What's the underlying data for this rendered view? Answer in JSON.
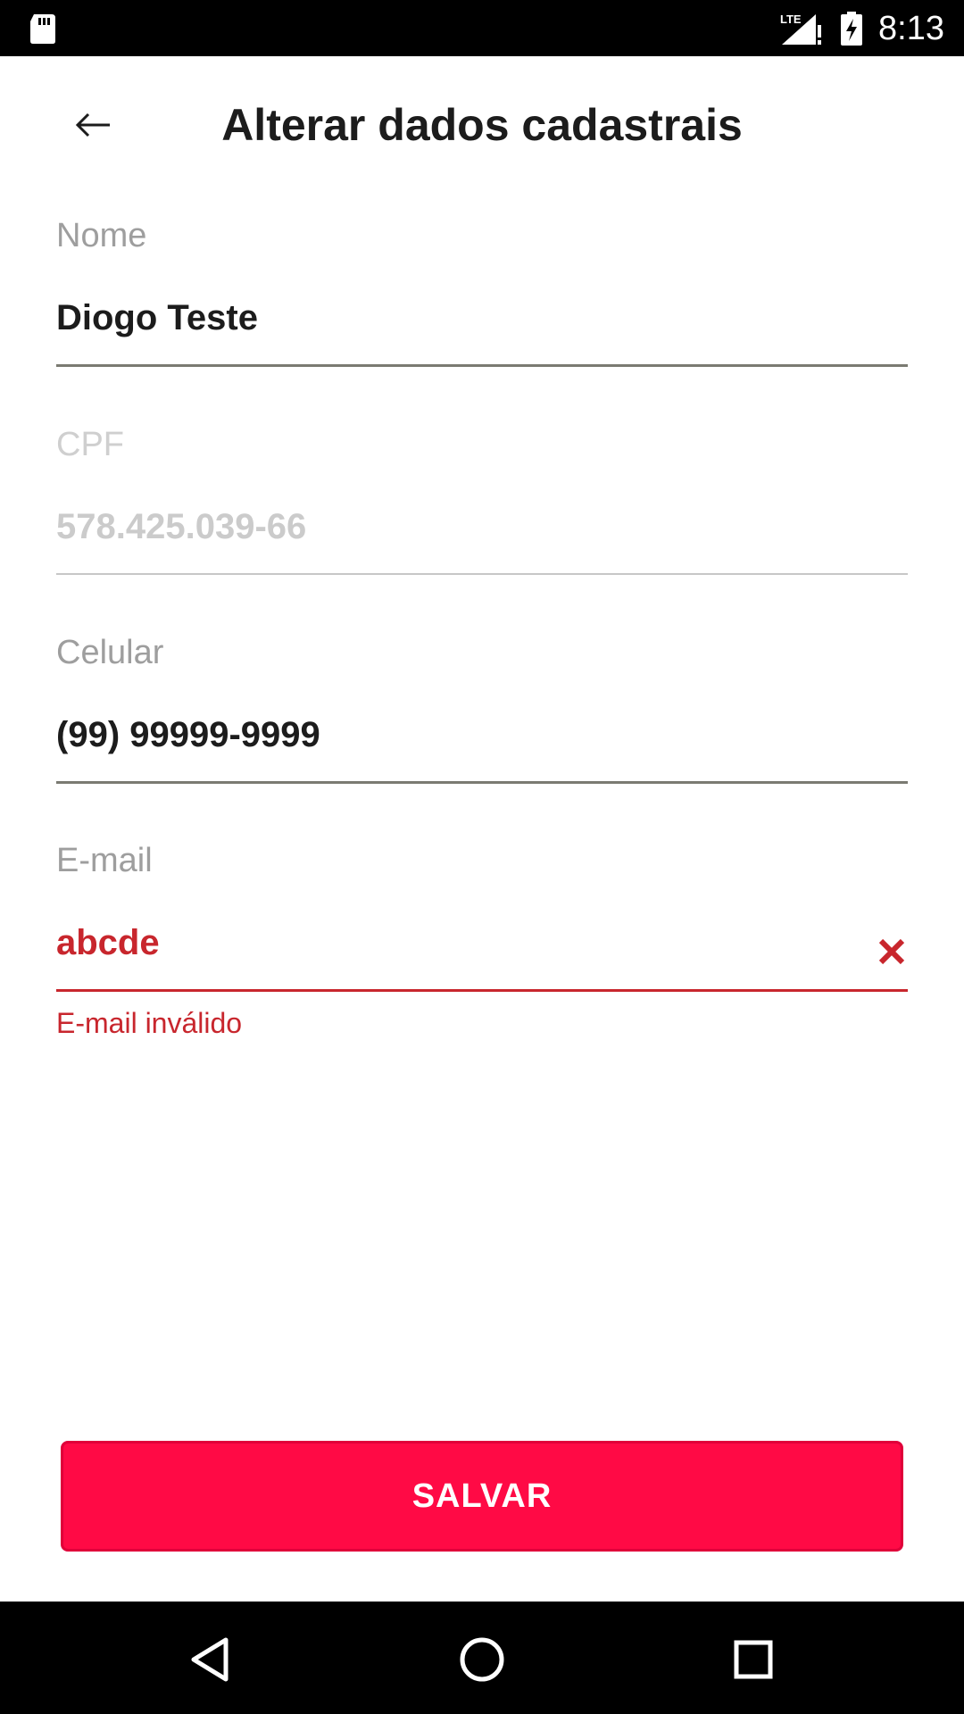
{
  "status_bar": {
    "time": "8:13",
    "icons": [
      "sd-card-icon",
      "lte-signal-icon",
      "battery-charging-icon"
    ],
    "lte_text": "LTE"
  },
  "header": {
    "title": "Alterar dados cadastrais",
    "back_icon": "arrow-left-icon"
  },
  "form": {
    "nome": {
      "label": "Nome",
      "value": "Diogo Teste"
    },
    "cpf": {
      "label": "CPF",
      "value": "578.425.039-66",
      "disabled": true
    },
    "celular": {
      "label": "Celular",
      "value": "(99) 99999-9999"
    },
    "email": {
      "label": "E-mail",
      "value": "abcde",
      "error": "E-mail inválido",
      "clear_icon": "close-icon"
    }
  },
  "save_button": {
    "label": "SALVAR"
  },
  "nav_bar": {
    "icons": [
      "back-triangle-icon",
      "home-circle-icon",
      "recents-square-icon"
    ]
  },
  "colors": {
    "accent": "#ff0a45",
    "error": "#c8262d",
    "text": "#1c1c1c",
    "label": "#9e9e9e"
  }
}
